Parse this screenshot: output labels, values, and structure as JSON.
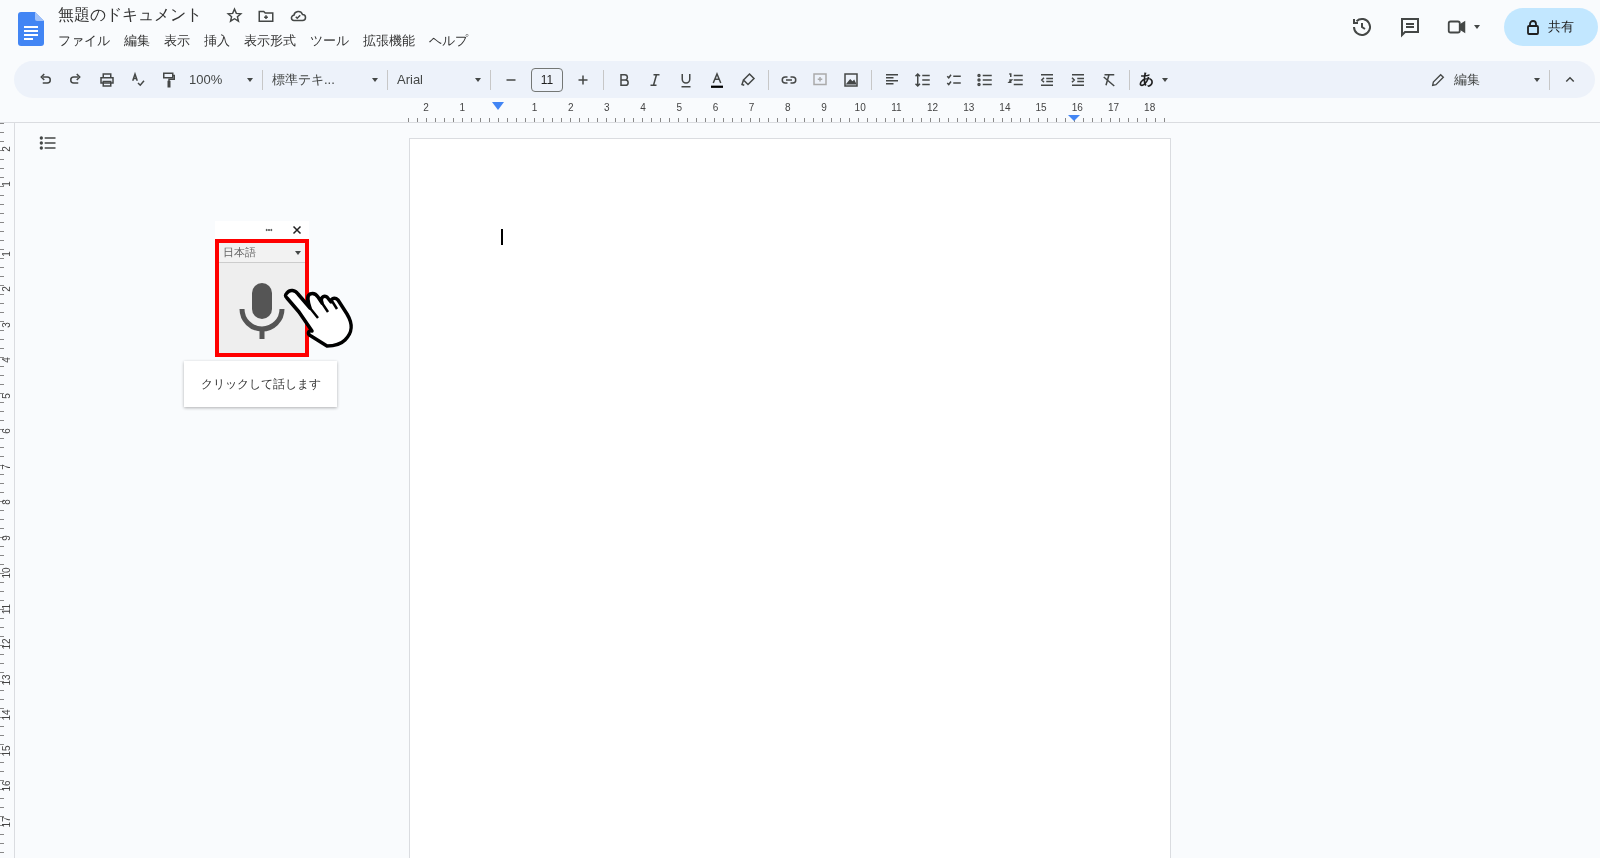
{
  "header": {
    "title": "無題のドキュメント",
    "menu": [
      "ファイル",
      "編集",
      "表示",
      "挿入",
      "表示形式",
      "ツール",
      "拡張機能",
      "ヘルプ"
    ],
    "share_button": "共有"
  },
  "toolbar": {
    "zoom": "100%",
    "style": "標準テキ...",
    "font": "Arial",
    "font_size": "11",
    "input_tool": "あ",
    "mode": "編集"
  },
  "ruler": {
    "horizontal": [
      "2",
      "1",
      "1",
      "2",
      "3",
      "4",
      "5",
      "6",
      "7",
      "8",
      "9",
      "10",
      "11",
      "12",
      "13",
      "14",
      "15",
      "16",
      "17",
      "18"
    ],
    "vertical": [
      "2",
      "1",
      "1",
      "2",
      "3",
      "4",
      "5",
      "6",
      "7",
      "8",
      "9",
      "10",
      "11",
      "12",
      "13",
      "14",
      "15",
      "16",
      "17"
    ]
  },
  "voice_typing": {
    "language": "日本語",
    "highlighted": true,
    "tooltip": "クリックして話します"
  }
}
